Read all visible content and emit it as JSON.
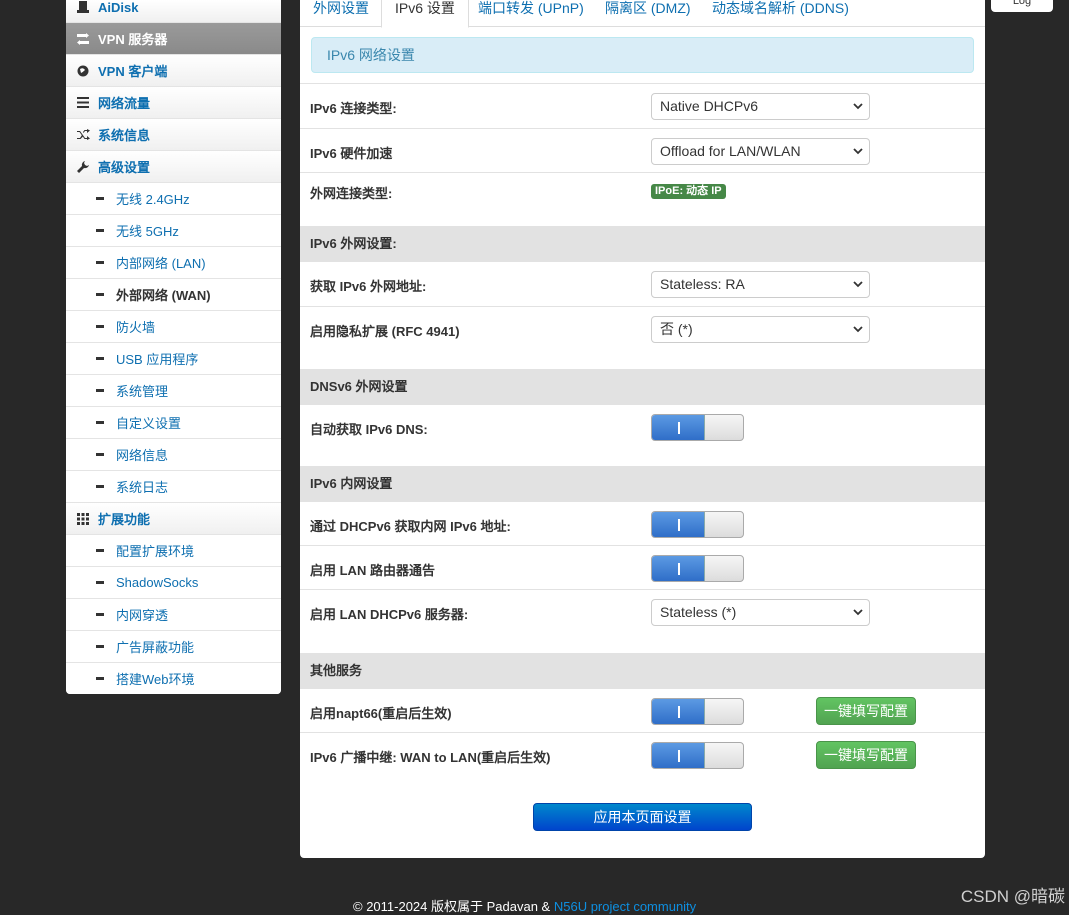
{
  "sidebar": {
    "items": [
      {
        "label": "AiDisk",
        "icon": "disk-icon"
      },
      {
        "label": "VPN 服务器",
        "icon": "vpn-server-icon"
      },
      {
        "label": "VPN 客户端",
        "icon": "globe-icon"
      },
      {
        "label": "网络流量",
        "icon": "list-icon"
      },
      {
        "label": "系统信息",
        "icon": "shuffle-icon"
      },
      {
        "label": "高级设置",
        "icon": "wrench-icon"
      }
    ],
    "advanced_sub": [
      "无线 2.4GHz",
      "无线 5GHz",
      "内部网络 (LAN)",
      "外部网络 (WAN)",
      "防火墙",
      "USB 应用程序",
      "系统管理",
      "自定义设置",
      "网络信息",
      "系统日志"
    ],
    "ext_label": "扩展功能",
    "ext_sub": [
      "配置扩展环境",
      "ShadowSocks",
      "内网穿透",
      "广告屏蔽功能",
      "搭建Web环境"
    ]
  },
  "tabs": [
    "外网设置",
    "IPv6 设置",
    "端口转发 (UPnP)",
    "隔离区 (DMZ)",
    "动态域名解析 (DDNS)"
  ],
  "alert": "IPv6 网络设置",
  "fields": {
    "conn_type_label": "IPv6 连接类型:",
    "conn_type_value": "Native DHCPv6",
    "hw_accel_label": "IPv6 硬件加速",
    "hw_accel_value": "Offload for LAN/WLAN",
    "wan_type_label": "外网连接类型:",
    "wan_type_badge": "IPoE: 动态 IP"
  },
  "sections": {
    "ipv6_wan": "IPv6 外网设置:",
    "dnsv6": "DNSv6 外网设置",
    "ipv6_lan": "IPv6 内网设置",
    "other": "其他服务"
  },
  "wan": {
    "get_addr_label": "获取 IPv6 外网地址:",
    "get_addr_value": "Stateless: RA",
    "privacy_label": "启用隐私扩展 (RFC 4941)",
    "privacy_value": "否 (*)"
  },
  "dns": {
    "auto_dns_label": "自动获取 IPv6 DNS:"
  },
  "lan": {
    "dhcp_addr_label": "通过 DHCPv6 获取内网 IPv6 地址:",
    "ra_label": "启用 LAN 路由器通告",
    "dhcpv6_server_label": "启用 LAN DHCPv6 服务器:",
    "dhcpv6_server_value": "Stateless (*)"
  },
  "other": {
    "napt66_label": "启用napt66(重启后生效)",
    "relay_label": "IPv6 广播中继: WAN to LAN(重启后生效)",
    "fill_btn": "一键填写配置"
  },
  "apply_btn": "应用本页面设置",
  "log_btn": "Log",
  "footer": {
    "text": "© 2011-2024 版权属于 Padavan & ",
    "link": "N56U project community"
  },
  "watermark": "CSDN @暗碳"
}
